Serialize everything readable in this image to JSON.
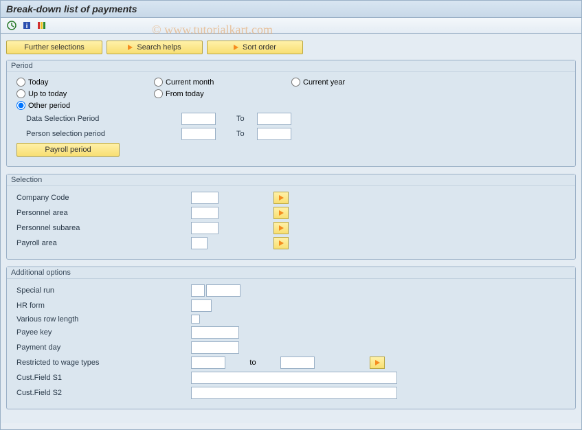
{
  "title": "Break-down list of payments",
  "watermark": "© www.tutorialkart.com",
  "toolbar": {
    "icons": [
      "clock",
      "info",
      "layout"
    ]
  },
  "topButtons": {
    "further": "Further selections",
    "search": "Search helps",
    "sort": "Sort order"
  },
  "period": {
    "legend": "Period",
    "radios": {
      "today": "Today",
      "currentMonth": "Current month",
      "currentYear": "Current year",
      "upToToday": "Up to today",
      "fromToday": "From today",
      "other": "Other period"
    },
    "selected": "other",
    "dataSelLabel": "Data Selection Period",
    "personSelLabel": "Person selection period",
    "toLabel": "To",
    "dataFrom": "",
    "dataTo": "",
    "personFrom": "",
    "personTo": "",
    "payrollBtn": "Payroll period"
  },
  "selection": {
    "legend": "Selection",
    "rows": [
      {
        "label": "Company Code",
        "value": ""
      },
      {
        "label": "Personnel area",
        "value": ""
      },
      {
        "label": "Personnel subarea",
        "value": ""
      },
      {
        "label": "Payroll area",
        "value": ""
      }
    ]
  },
  "additional": {
    "legend": "Additional options",
    "specialRun": {
      "label": "Special run",
      "v1": "",
      "v2": ""
    },
    "hrForm": {
      "label": "HR form",
      "value": ""
    },
    "various": {
      "label": "Various row length",
      "checked": false
    },
    "payee": {
      "label": "Payee key",
      "value": ""
    },
    "payday": {
      "label": "Payment day",
      "value": ""
    },
    "restricted": {
      "label": "Restricted to wage types",
      "from": "",
      "to": "",
      "toLabel": "to"
    },
    "cust1": {
      "label": "Cust.Field S1",
      "value": ""
    },
    "cust2": {
      "label": "Cust.Field S2",
      "value": ""
    }
  }
}
